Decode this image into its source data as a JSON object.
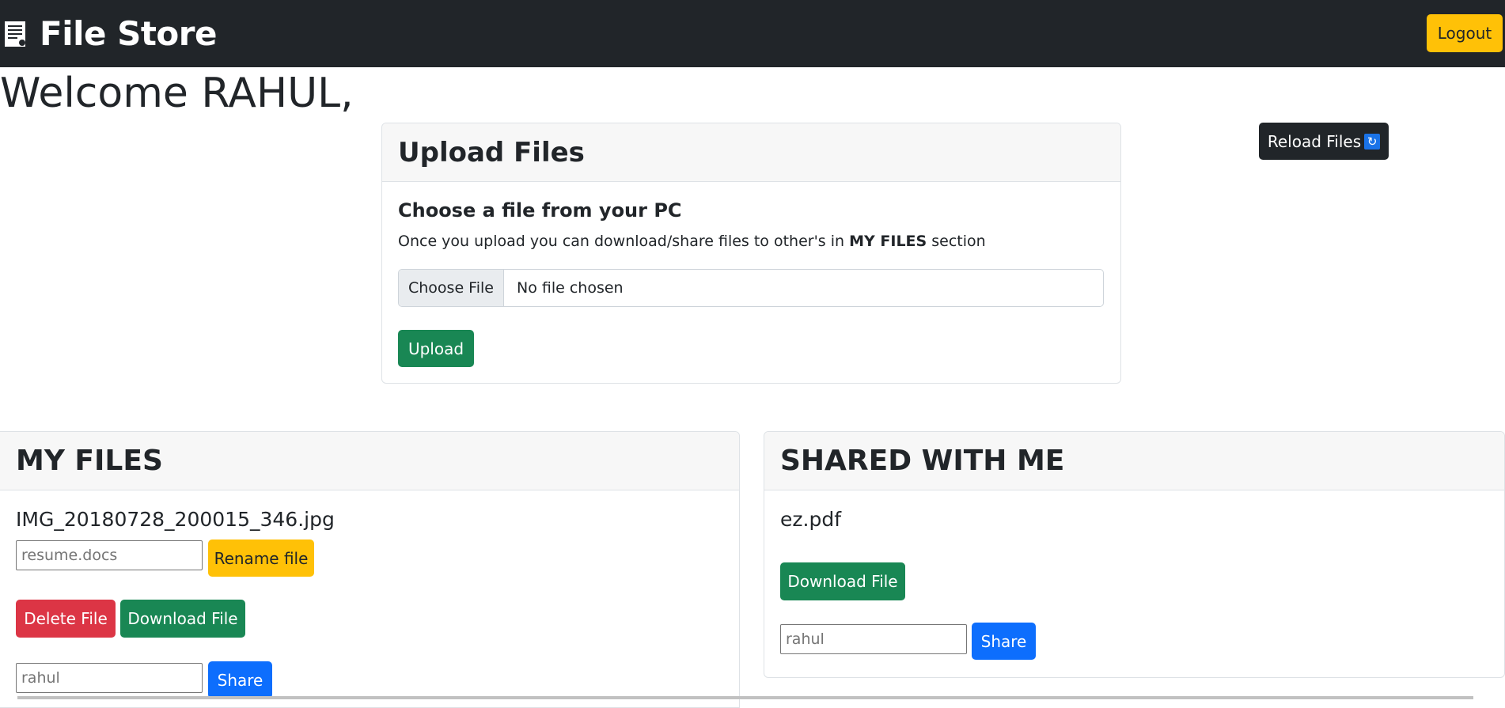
{
  "navbar": {
    "brand_icon": "document-icon",
    "brand": "File Store",
    "logout_label": "Logout"
  },
  "welcome": "Welcome RAHUL,",
  "upload": {
    "title": "Upload Files",
    "subtitle": "Choose a file from your PC",
    "desc_before": "Once you upload you can download/share files to other's in ",
    "desc_bold": "MY FILES",
    "desc_after": " section",
    "choose_label": "Choose File",
    "no_file": "No file chosen",
    "upload_label": "Upload"
  },
  "reload": {
    "label": "Reload Files",
    "icon": "refresh-icon"
  },
  "my_files": {
    "title": "MY FILES",
    "file_name": "IMG_20180728_200015_346.jpg",
    "rename_placeholder": "resume.docs",
    "rename_label": "Rename file",
    "delete_label": "Delete File",
    "download_label": "Download File",
    "share_placeholder": "rahul",
    "share_label": "Share"
  },
  "shared": {
    "title": "SHARED WITH ME",
    "file_name": "ez.pdf",
    "download_label": "Download File",
    "share_placeholder": "rahul",
    "share_label": "Share"
  },
  "colors": {
    "navbar": "#212529",
    "warning": "#ffc107",
    "success": "#198754",
    "danger": "#dc3545",
    "primary": "#0d6efd"
  }
}
